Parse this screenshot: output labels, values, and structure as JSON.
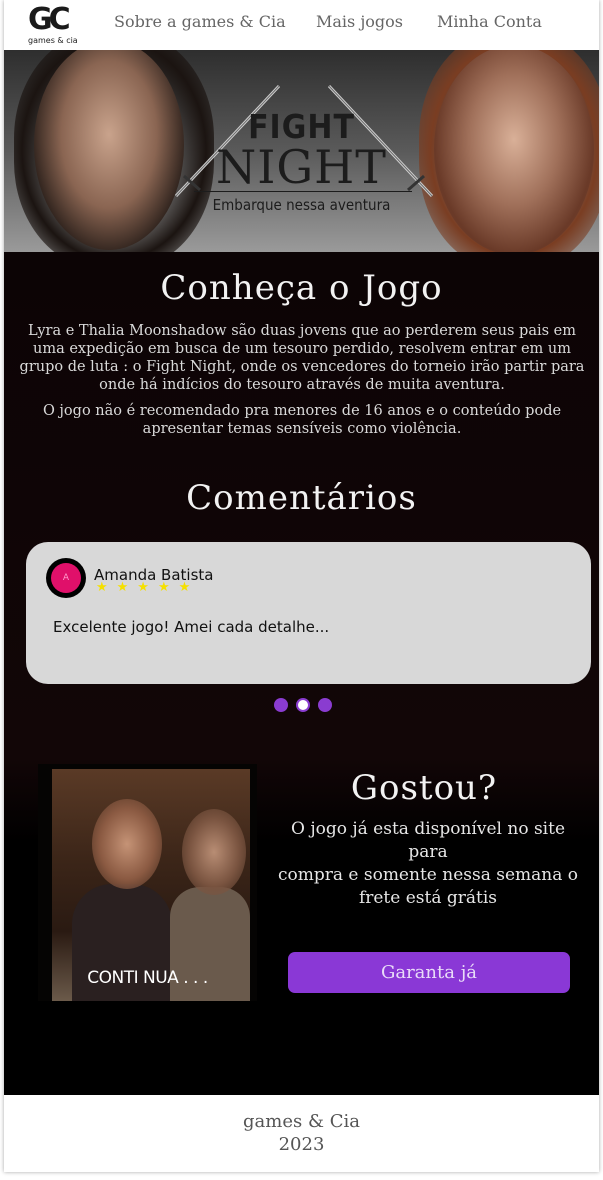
{
  "header": {
    "logo_letters": "GC",
    "logo_sub": "games & cia",
    "nav": [
      "Sobre a games & Cia",
      "Mais jogos",
      "Minha Conta"
    ]
  },
  "hero": {
    "title_small": "FIGHT",
    "title_big": "NIGHT",
    "tagline": "Embarque nessa aventura"
  },
  "about": {
    "heading": "Conheça o Jogo",
    "paragraph1": "Lyra e Thalia Moonshadow são duas jovens que ao perderem seus pais em uma expedição em busca de um tesouro perdido, resolvem entrar em um grupo de luta : o Fight Night, onde os vencedores do torneio irão partir para onde há indícios do tesouro através de muita aventura.",
    "paragraph2": "O jogo não é recomendado pra menores de 16 anos e o conteúdo pode apresentar temas sensíveis como violência."
  },
  "comments": {
    "heading": "Comentários",
    "items": [
      {
        "avatar_letter": "A",
        "name": "Amanda Batista",
        "stars": "★★★★★",
        "rating": 5,
        "text": "Excelente jogo! Amei cada detalhe..."
      }
    ],
    "carousel_count": 3,
    "carousel_active": 2
  },
  "promo": {
    "image_caption": "CONTI NUA . . .",
    "heading": "Gostou?",
    "line1": "O jogo já esta disponível no site para",
    "line2": "compra e somente nessa semana o",
    "line3": "frete está grátis",
    "cta": "Garanta já"
  },
  "footer": {
    "brand": "games & Cia",
    "year": "2023"
  },
  "colors": {
    "accent": "#8a38d6",
    "stars": "#f5e000",
    "avatar": "#e0106a",
    "dark_bg": "#0c0405"
  }
}
